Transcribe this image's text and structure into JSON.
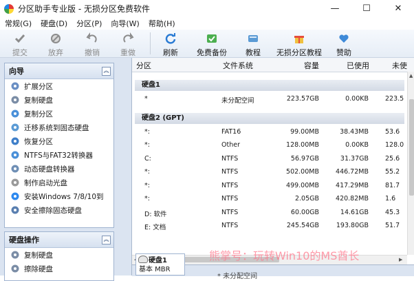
{
  "window": {
    "title": "分区助手专业版 - 无损分区免费软件",
    "minimize": "—",
    "maximize": "☐",
    "close": "✕"
  },
  "menu": [
    "常规(G)",
    "硬盘(D)",
    "分区(P)",
    "向导(W)",
    "帮助(H)"
  ],
  "toolbar": {
    "commit": "提交",
    "discard": "放弃",
    "undo": "撤销",
    "redo": "重做",
    "refresh": "刷新",
    "free_backup": "免费备份",
    "tutorial": "教程",
    "lossless_tutorial": "无损分区教程",
    "donate": "赞助"
  },
  "wizard_panel": {
    "title": "向导",
    "items": [
      {
        "label": "扩展分区",
        "icon": "extend-partition-icon"
      },
      {
        "label": "复制硬盘",
        "icon": "copy-disk-icon"
      },
      {
        "label": "复制分区",
        "icon": "copy-partition-icon"
      },
      {
        "label": "迁移系统到固态硬盘",
        "icon": "migrate-os-icon"
      },
      {
        "label": "恢复分区",
        "icon": "recover-partition-icon"
      },
      {
        "label": "NTFS与FAT32转换器",
        "icon": "ntfs-fat32-icon"
      },
      {
        "label": "动态硬盘转换器",
        "icon": "dynamic-disk-icon"
      },
      {
        "label": "制作启动光盘",
        "icon": "bootable-cd-icon"
      },
      {
        "label": "安装Windows 7/8/10到",
        "icon": "install-windows-icon"
      },
      {
        "label": "安全擦除固态硬盘",
        "icon": "ssd-erase-icon"
      }
    ]
  },
  "disk_ops_panel": {
    "title": "硬盘操作",
    "items": [
      {
        "label": "复制硬盘",
        "icon": "copy-disk-icon"
      },
      {
        "label": "擦除硬盘",
        "icon": "wipe-disk-icon"
      }
    ]
  },
  "columns": {
    "partition": "分区",
    "filesystem": "文件系统",
    "capacity": "容量",
    "used": "已使用",
    "unused": "未使"
  },
  "disks": [
    {
      "header": "硬盘1",
      "rows": [
        {
          "name": "*",
          "fs": "未分配空间",
          "cap": "223.57GB",
          "used": "0.00KB",
          "unused": "223.5"
        }
      ]
    },
    {
      "header": "硬盘2 (GPT)",
      "rows": [
        {
          "name": "*:",
          "fs": "FAT16",
          "cap": "99.00MB",
          "used": "38.43MB",
          "unused": "53.6"
        },
        {
          "name": "*:",
          "fs": "Other",
          "cap": "128.00MB",
          "used": "0.00KB",
          "unused": "128.0"
        },
        {
          "name": "C:",
          "fs": "NTFS",
          "cap": "56.97GB",
          "used": "31.37GB",
          "unused": "25.6"
        },
        {
          "name": "*:",
          "fs": "NTFS",
          "cap": "502.00MB",
          "used": "446.72MB",
          "unused": "55.2"
        },
        {
          "name": "*:",
          "fs": "NTFS",
          "cap": "499.00MB",
          "used": "417.29MB",
          "unused": "81.7"
        },
        {
          "name": "*:",
          "fs": "NTFS",
          "cap": "2.05GB",
          "used": "420.82MB",
          "unused": "1.6"
        },
        {
          "name": "D: 软件",
          "fs": "NTFS",
          "cap": "60.00GB",
          "used": "14.61GB",
          "unused": "45.3"
        },
        {
          "name": "E: 文档",
          "fs": "NTFS",
          "cap": "245.54GB",
          "used": "193.80GB",
          "unused": "51.7"
        }
      ]
    }
  ],
  "disk_card": {
    "title": "硬盘1",
    "subtitle": "基本 MBR"
  },
  "watermark": "熊掌号：玩转Win10的MS酋长",
  "strip_text": "* 未分配空间"
}
